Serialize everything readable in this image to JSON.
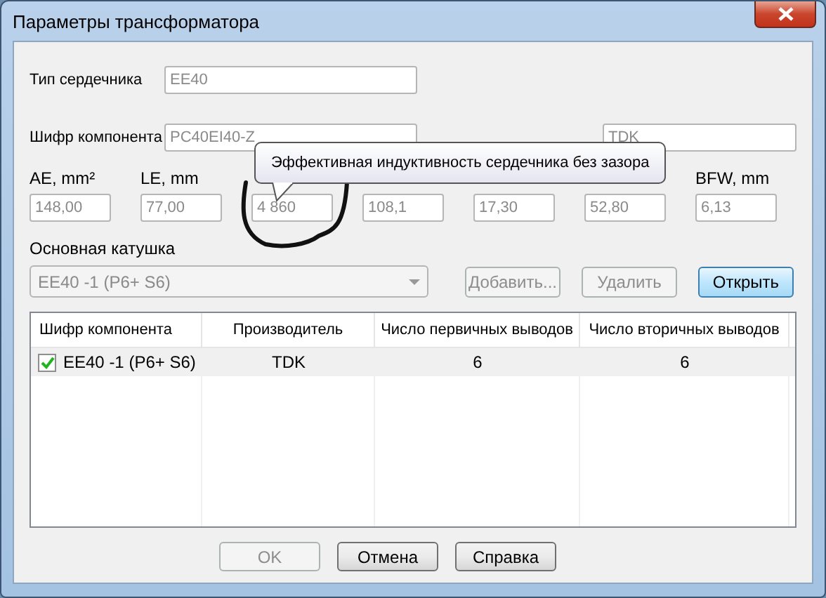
{
  "window": {
    "title": "Параметры трансформатора"
  },
  "core_type": {
    "label": "Тип сердечника",
    "value": "EE40"
  },
  "component_code": {
    "label": "Шифр компонента",
    "value": "PC40EI40-Z"
  },
  "manufacturer": {
    "value": "TDK"
  },
  "tooltip": {
    "text": "Эффективная индуктивность сердечника без зазора"
  },
  "parameters": [
    {
      "label": "AE, mm²",
      "value": "148,00",
      "circled": false
    },
    {
      "label": "LE, mm",
      "value": "77,00",
      "circled": false
    },
    {
      "value": "4 860",
      "circled": true
    },
    {
      "value": "108,1",
      "circled": false
    },
    {
      "value": "17,30",
      "circled": false
    },
    {
      "value": "52,80",
      "circled": false
    },
    {
      "label": "BFW, mm",
      "value": "6,13",
      "circled": false
    }
  ],
  "main_coil": {
    "label": "Основная катушка",
    "value": "EE40 -1 (P6+ S6)",
    "disabled": true
  },
  "coil_buttons": [
    {
      "label": "Добавить...",
      "disabled": true,
      "default": false
    },
    {
      "label": "Удалить",
      "disabled": true,
      "default": false
    },
    {
      "label": "Открыть",
      "disabled": false,
      "default": true
    }
  ],
  "table": {
    "columns": [
      "Шифр компонента",
      "Производитель",
      "Число первичных выводов",
      "Число вторичных выводов"
    ],
    "rows": [
      {
        "checked": true,
        "cells": [
          "EE40 -1 (P6+ S6)",
          "TDK",
          "6",
          "6"
        ]
      }
    ]
  },
  "buttons": [
    {
      "label": "OK",
      "disabled": true
    },
    {
      "label": "Отмена",
      "disabled": false
    },
    {
      "label": "Справка",
      "disabled": false
    }
  ]
}
